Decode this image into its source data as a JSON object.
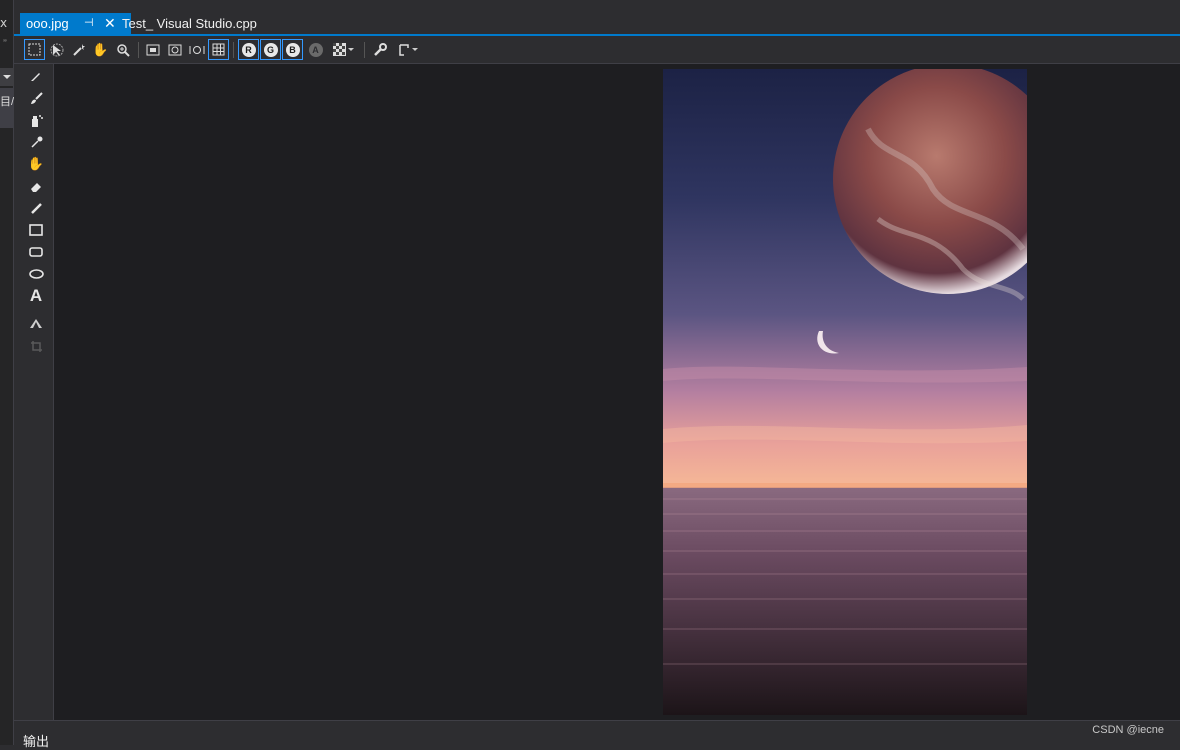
{
  "left_panel": {
    "close_glyph": "x",
    "dots": "’’",
    "item": "目/"
  },
  "tabs": [
    {
      "label": "ooo.jpg",
      "active": true,
      "pin_icon": "pin-icon",
      "close_icon": "close-icon"
    },
    {
      "label": "Test_ Visual Studio.cpp",
      "active": false
    }
  ],
  "toolbar": {
    "items": [
      "rect-select-icon",
      "lasso-select-icon",
      "magic-wand-icon",
      "pan-hand-icon",
      "zoom-icon",
      "zoom-fit-icon",
      "zoom-actual-icon",
      "zoom-out-icon",
      "grid-icon",
      "channel-r",
      "channel-g",
      "channel-b",
      "channel-a",
      "transparency-icon",
      "wrench-icon",
      "format-icon"
    ],
    "channels": {
      "r": "R",
      "g": "G",
      "b": "B",
      "a": "A"
    }
  },
  "tools": [
    "pencil-icon",
    "brush-icon",
    "airbrush-icon",
    "eyedropper-icon",
    "fill-icon",
    "eraser-icon",
    "line-icon",
    "rectangle-icon",
    "rounded-rect-icon",
    "ellipse-icon",
    "text-icon",
    "rotate-icon",
    "crop-icon"
  ],
  "text_tool_glyph": "A",
  "image": {
    "description_hidden": "",
    "alt": ""
  },
  "bottom": {
    "output_label": "输出",
    "watermark": "CSDN @iecne"
  },
  "colors": {
    "accent": "#007acc",
    "canvas": "#1e1e21",
    "chrome": "#2d2d30"
  }
}
